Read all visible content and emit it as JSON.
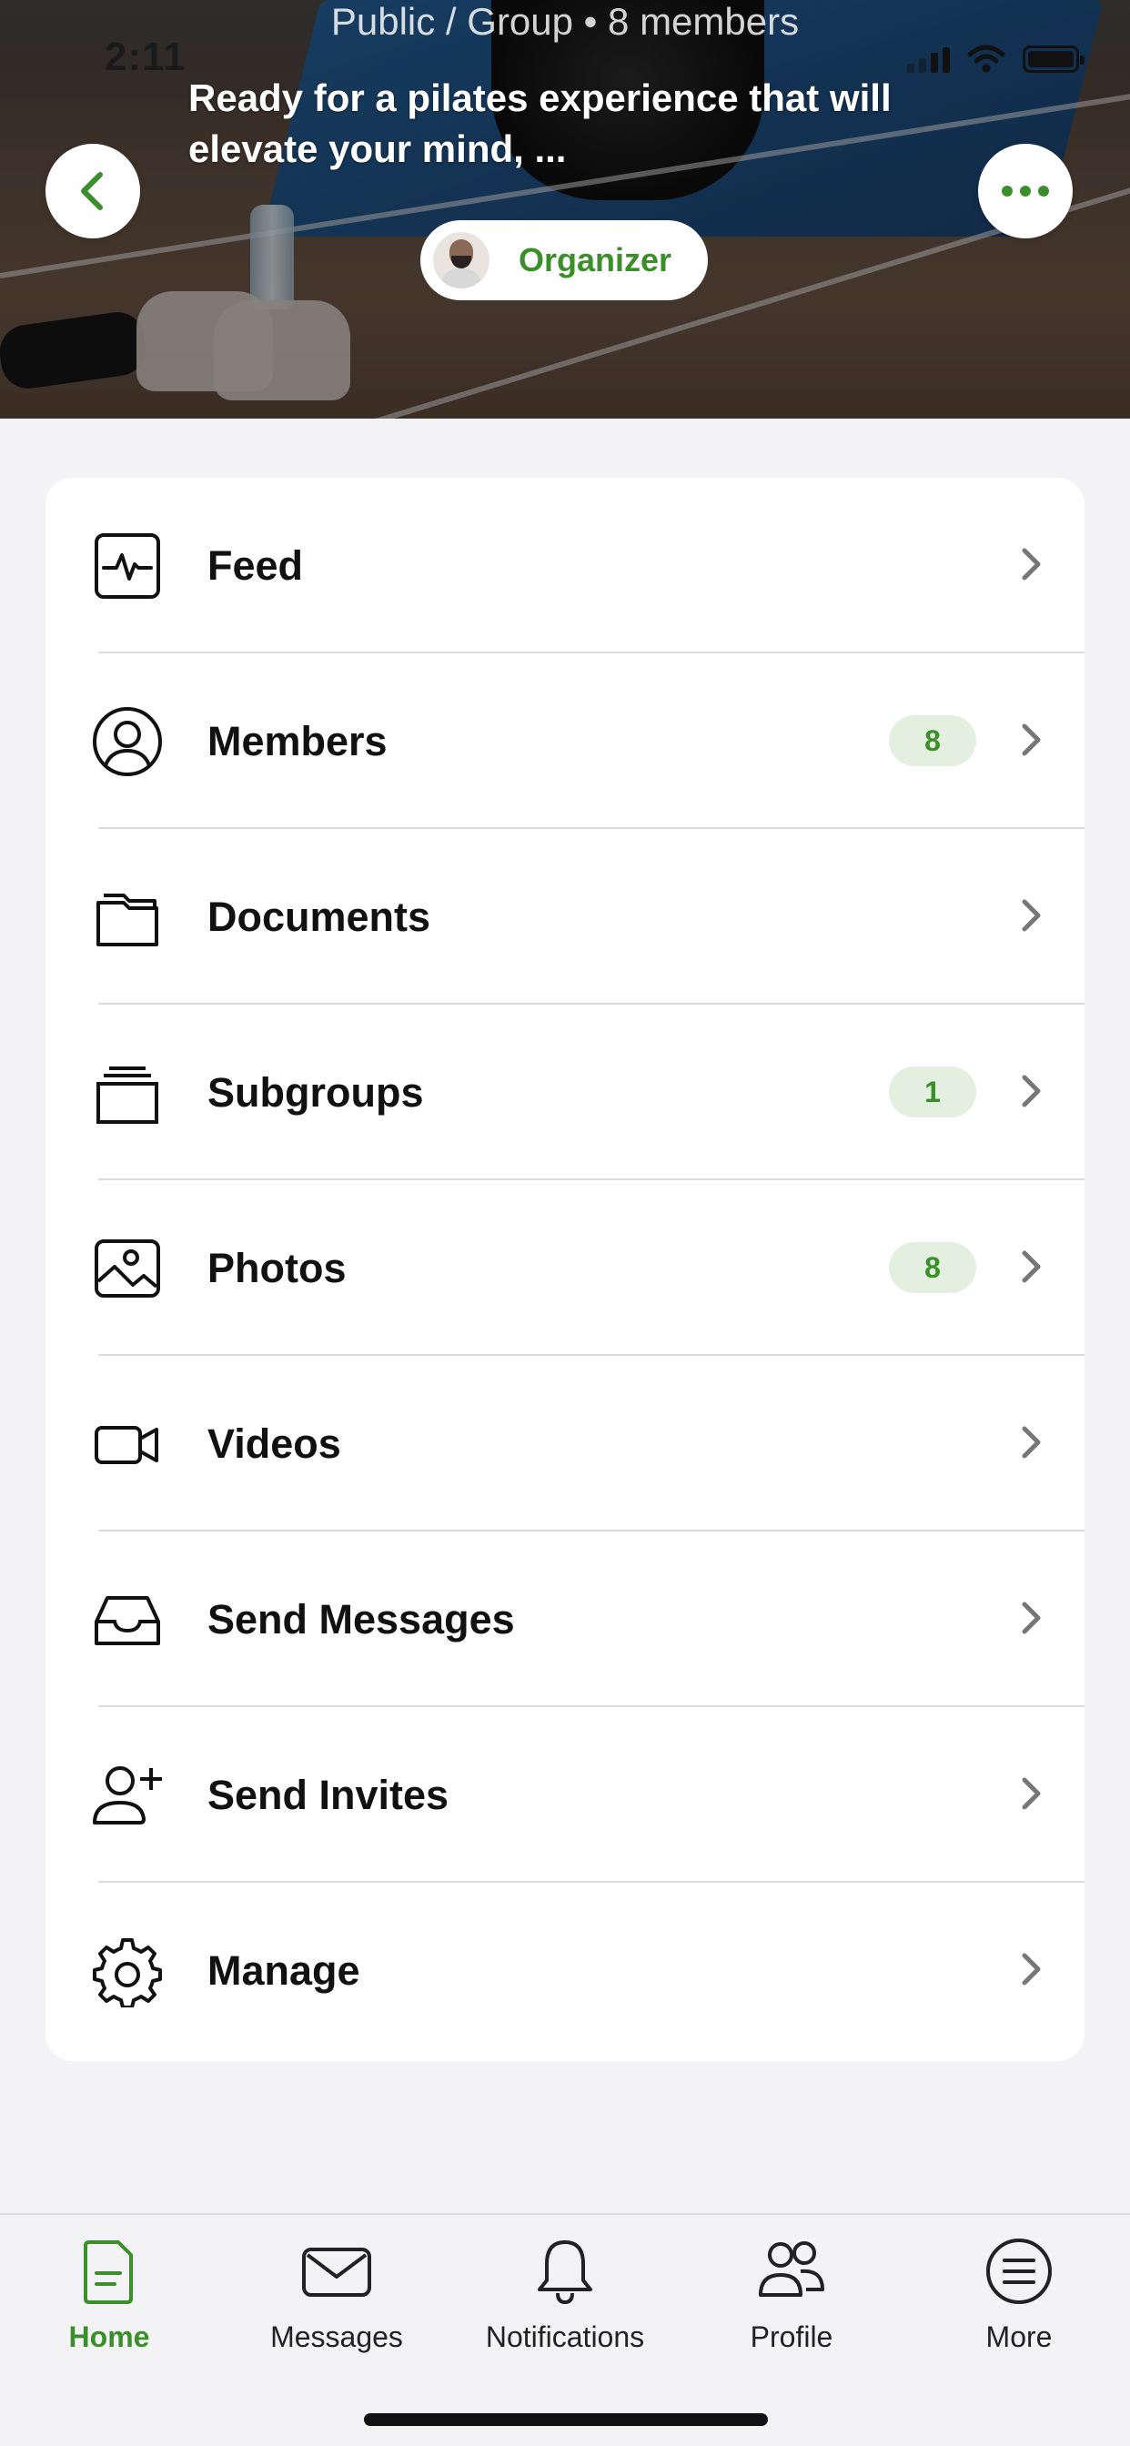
{
  "status_bar": {
    "time": "2:11"
  },
  "hero": {
    "meta": "Public / Group • 8 members",
    "description": "Ready for a pilates experience that will elevate your mind, ...",
    "organizer_label": "Organizer"
  },
  "menu": {
    "items": [
      {
        "label": "Feed",
        "icon": "activity-icon",
        "badge": ""
      },
      {
        "label": "Members",
        "icon": "user-circle-icon",
        "badge": "8"
      },
      {
        "label": "Documents",
        "icon": "folder-icon",
        "badge": ""
      },
      {
        "label": "Subgroups",
        "icon": "stack-icon",
        "badge": "1"
      },
      {
        "label": "Photos",
        "icon": "image-icon",
        "badge": "8"
      },
      {
        "label": "Videos",
        "icon": "video-camera-icon",
        "badge": ""
      },
      {
        "label": "Send Messages",
        "icon": "inbox-icon",
        "badge": ""
      },
      {
        "label": "Send Invites",
        "icon": "user-plus-icon",
        "badge": ""
      },
      {
        "label": "Manage",
        "icon": "gear-icon",
        "badge": ""
      }
    ]
  },
  "tabbar": {
    "tabs": [
      {
        "label": "Home",
        "icon": "home-document-icon",
        "active": true
      },
      {
        "label": "Messages",
        "icon": "envelope-icon",
        "active": false
      },
      {
        "label": "Notifications",
        "icon": "bell-icon",
        "active": false
      },
      {
        "label": "Profile",
        "icon": "people-icon",
        "active": false
      },
      {
        "label": "More",
        "icon": "list-circle-icon",
        "active": false
      }
    ]
  },
  "colors": {
    "accent": "#3b8f2a",
    "badge_bg": "#e3f0df",
    "background": "#f3f3f5",
    "card": "#ffffff"
  }
}
